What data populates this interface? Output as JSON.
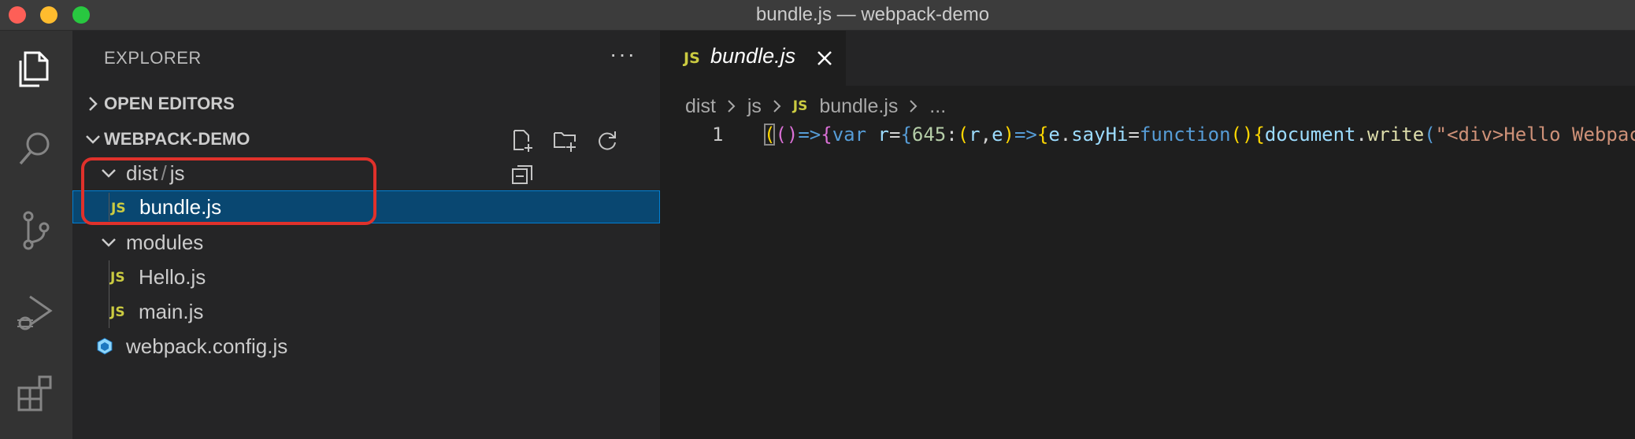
{
  "window": {
    "title": "bundle.js — webpack-demo"
  },
  "activity_bar": {
    "icons": [
      "explorer-icon",
      "search-icon",
      "source-control-icon",
      "run-debug-icon",
      "extensions-icon"
    ]
  },
  "explorer": {
    "title": "EXPLORER",
    "more_label": "···",
    "open_editors_label": "OPEN EDITORS",
    "project_label": "WEBPACK-DEMO",
    "tree": [
      {
        "label_parts": [
          "dist",
          "/",
          "js"
        ],
        "type": "folder"
      },
      {
        "label": "bundle.js",
        "type": "js",
        "selected": true
      },
      {
        "label": "modules",
        "type": "folder"
      },
      {
        "label": "Hello.js",
        "type": "js"
      },
      {
        "label": "main.js",
        "type": "js"
      },
      {
        "label": "webpack.config.js",
        "type": "webpack"
      }
    ],
    "js_badge": "JS"
  },
  "editor": {
    "tab": {
      "label": "bundle.js",
      "badge": "JS"
    },
    "breadcrumb": [
      "dist",
      "js",
      "bundle.js",
      "..."
    ],
    "line_number": "1",
    "code_tokens": [
      [
        "(",
        "gold cursor"
      ],
      [
        "()",
        "pink"
      ],
      [
        "=>",
        "kw"
      ],
      [
        "{",
        "pink"
      ],
      [
        "var",
        "kw"
      ],
      [
        " ",
        "punc"
      ],
      [
        "r",
        "var"
      ],
      [
        "=",
        "punc"
      ],
      [
        "{",
        "kw"
      ],
      [
        "645",
        "num"
      ],
      [
        ":",
        "punc"
      ],
      [
        "(",
        "gold"
      ],
      [
        "r",
        "var"
      ],
      [
        ",",
        "punc"
      ],
      [
        "e",
        "var"
      ],
      [
        ")",
        "gold"
      ],
      [
        "=>",
        "kw"
      ],
      [
        "{",
        "gold"
      ],
      [
        "e",
        "var"
      ],
      [
        ".",
        "punc"
      ],
      [
        "sayHi",
        "var"
      ],
      [
        "=",
        "punc"
      ],
      [
        "function",
        "kw"
      ],
      [
        "()",
        "gold"
      ],
      [
        "{",
        "gold"
      ],
      [
        "document",
        "var"
      ],
      [
        ".",
        "punc"
      ],
      [
        "write",
        "fn"
      ],
      [
        "(",
        "kw"
      ],
      [
        "\"<div>Hello Webpack",
        "str"
      ]
    ]
  },
  "colors": {
    "activity_bar": "#333333",
    "sidebar": "#252526",
    "editor": "#1e1e1e",
    "selection": "#094771",
    "highlight_box": "#e0312b",
    "js_badge": "#cbcb41"
  }
}
